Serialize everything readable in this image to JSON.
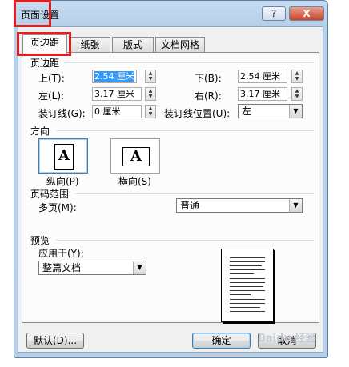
{
  "window": {
    "title": "页面设置",
    "help_label": "?",
    "close_label": "X"
  },
  "tabs": [
    {
      "label": "页边距",
      "active": true
    },
    {
      "label": "纸张",
      "active": false
    },
    {
      "label": "版式",
      "active": false
    },
    {
      "label": "文档网格",
      "active": false
    }
  ],
  "margins": {
    "section_label": "页边距",
    "top": {
      "label": "上(T):",
      "value": "2.54 厘米"
    },
    "bottom": {
      "label": "下(B):",
      "value": "2.54 厘米"
    },
    "left": {
      "label": "左(L):",
      "value": "3.17 厘米"
    },
    "right": {
      "label": "右(R):",
      "value": "3.17 厘米"
    },
    "gutter": {
      "label": "装订线(G):",
      "value": "0 厘米"
    },
    "gutter_position": {
      "label": "装订线位置(U):",
      "value": "左"
    }
  },
  "orientation": {
    "section_label": "方向",
    "portrait_label": "纵向(P)",
    "landscape_label": "横向(S)",
    "icon_letter": "A",
    "selected": "portrait"
  },
  "pages": {
    "section_label": "页码范围",
    "multiple_label": "多页(M):",
    "multiple_value": "普通"
  },
  "preview": {
    "section_label": "预览",
    "apply_label": "应用于(Y):",
    "apply_value": "整篇文档"
  },
  "buttons": {
    "default_label": "默认(D)...",
    "ok_label": "确定",
    "cancel_label": "取消"
  },
  "watermark": "Baidu 经验",
  "colors": {
    "highlight": "#e02020",
    "selection": "#3399ff"
  }
}
